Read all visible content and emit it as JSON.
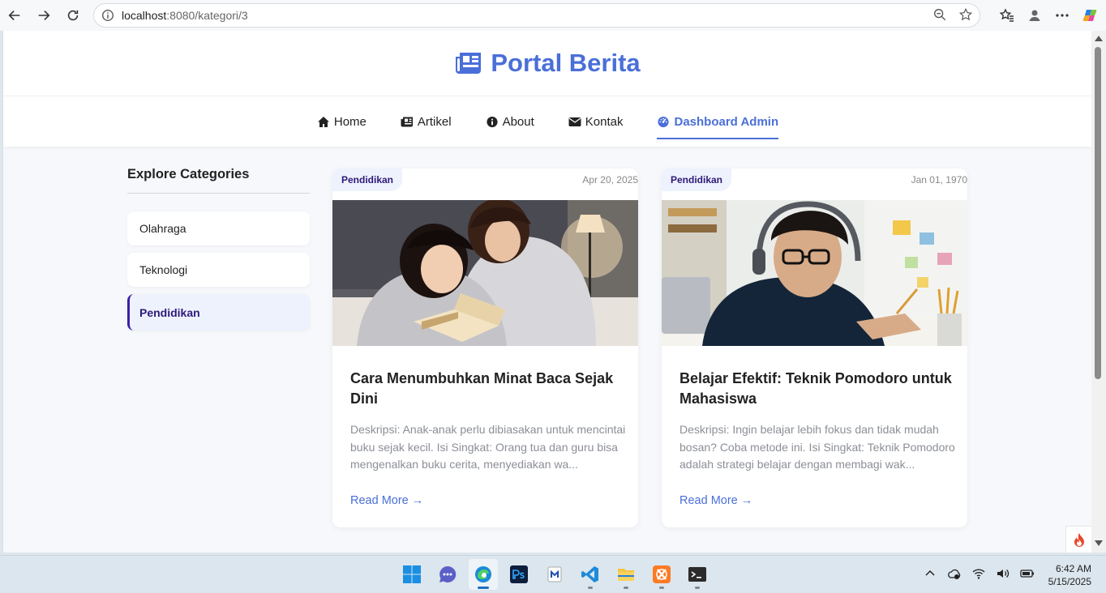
{
  "browser": {
    "url_host": "localhost",
    "url_rest": ":8080/kategori/3"
  },
  "site": {
    "brand": "Portal Berita",
    "nav": [
      {
        "label": "Home",
        "icon": "home-icon"
      },
      {
        "label": "Artikel",
        "icon": "newspaper-icon"
      },
      {
        "label": "About",
        "icon": "info-icon"
      },
      {
        "label": "Kontak",
        "icon": "envelope-icon"
      },
      {
        "label": "Dashboard Admin",
        "icon": "dashboard-icon",
        "active": true
      }
    ]
  },
  "sidebar": {
    "heading": "Explore Categories",
    "items": [
      {
        "label": "Olahraga"
      },
      {
        "label": "Teknologi"
      },
      {
        "label": "Pendidikan",
        "active": true
      }
    ]
  },
  "articles": [
    {
      "category": "Pendidikan",
      "date": "Apr 20, 2025",
      "title": "Cara Menumbuhkan Minat Baca Sejak Dini",
      "desc": "Deskripsi: Anak-anak perlu dibiasakan untuk mencintai buku sejak kecil. Isi Singkat: Orang tua dan guru bisa mengenalkan buku cerita, menyediakan wa...",
      "more": "Read More →"
    },
    {
      "category": "Pendidikan",
      "date": "Jan 01, 1970",
      "title": "Belajar Efektif: Teknik Pomodoro untuk Mahasiswa",
      "desc": "Deskripsi: Ingin belajar lebih fokus dan tidak mudah bosan? Coba metode ini. Isi Singkat: Teknik Pomodoro adalah strategi belajar dengan membagi wak...",
      "more": "Read More →"
    }
  ],
  "taskbar": {
    "time": "6:42 AM",
    "date": "5/15/2025"
  },
  "colors": {
    "brand": "#4a6fd8",
    "accent_purple": "#3e1ea6"
  }
}
